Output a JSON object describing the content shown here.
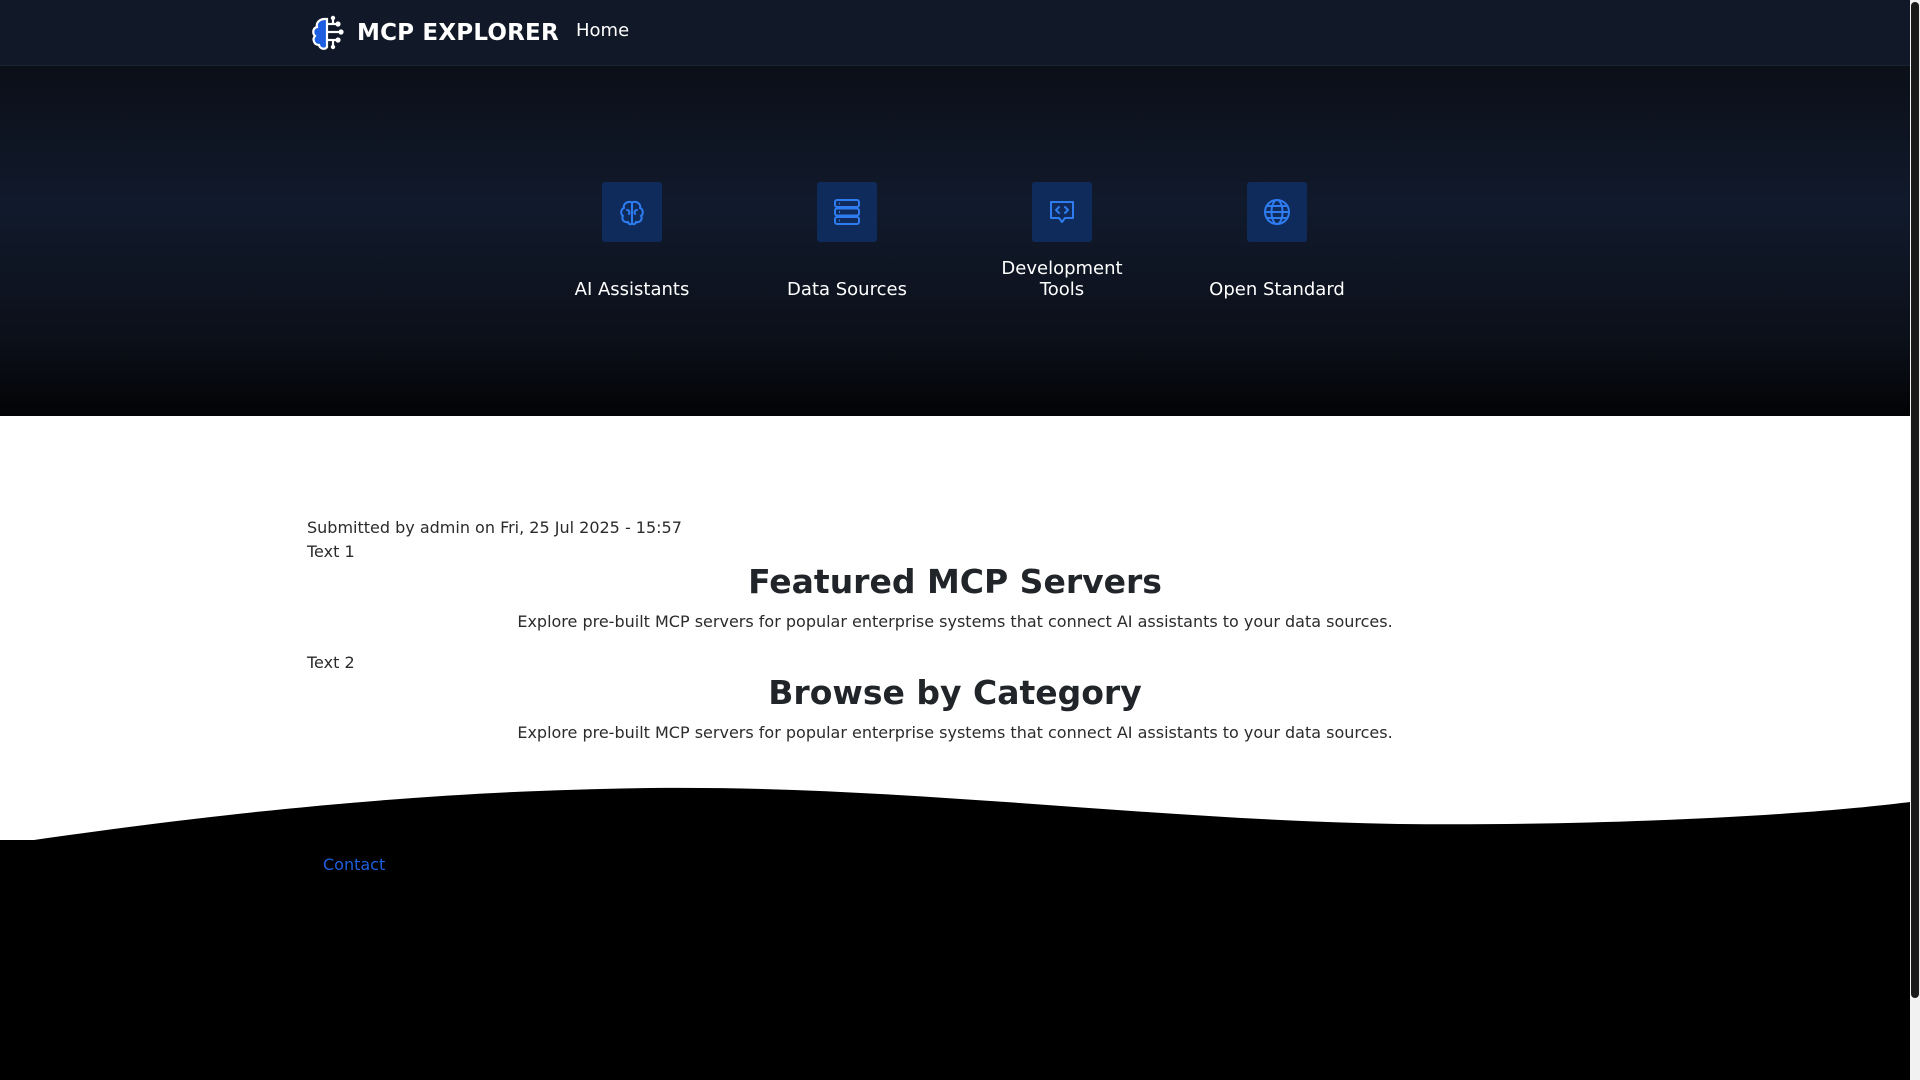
{
  "header": {
    "brand": "MCP EXPLORER",
    "nav": {
      "home": "Home"
    }
  },
  "hero": {
    "features": [
      {
        "label": "AI Assistants",
        "icon": "brain-icon"
      },
      {
        "label": "Data Sources",
        "icon": "database-icon"
      },
      {
        "label": "Development",
        "label2": "Tools",
        "icon": "code-message-icon"
      },
      {
        "label": "Open Standard",
        "icon": "globe-icon"
      }
    ]
  },
  "content": {
    "submitted": "Submitted by admin on Fri, 25 Jul 2025 - 15:57",
    "sections": [
      {
        "tag": "Text 1",
        "title": "Featured MCP Servers",
        "description": "Explore pre-built MCP servers for popular enterprise systems that connect AI assistants to your data sources."
      },
      {
        "tag": "Text 2",
        "title": "Browse by Category",
        "description": "Explore pre-built MCP servers for popular enterprise systems that connect AI assistants to your data sources."
      }
    ]
  },
  "footer": {
    "contact": "Contact"
  },
  "colors": {
    "header_bg": "#111827",
    "accent_blue": "#1d5fe0",
    "icon_box": "#0f2b5c",
    "icon_stroke": "#2f7bf0"
  }
}
